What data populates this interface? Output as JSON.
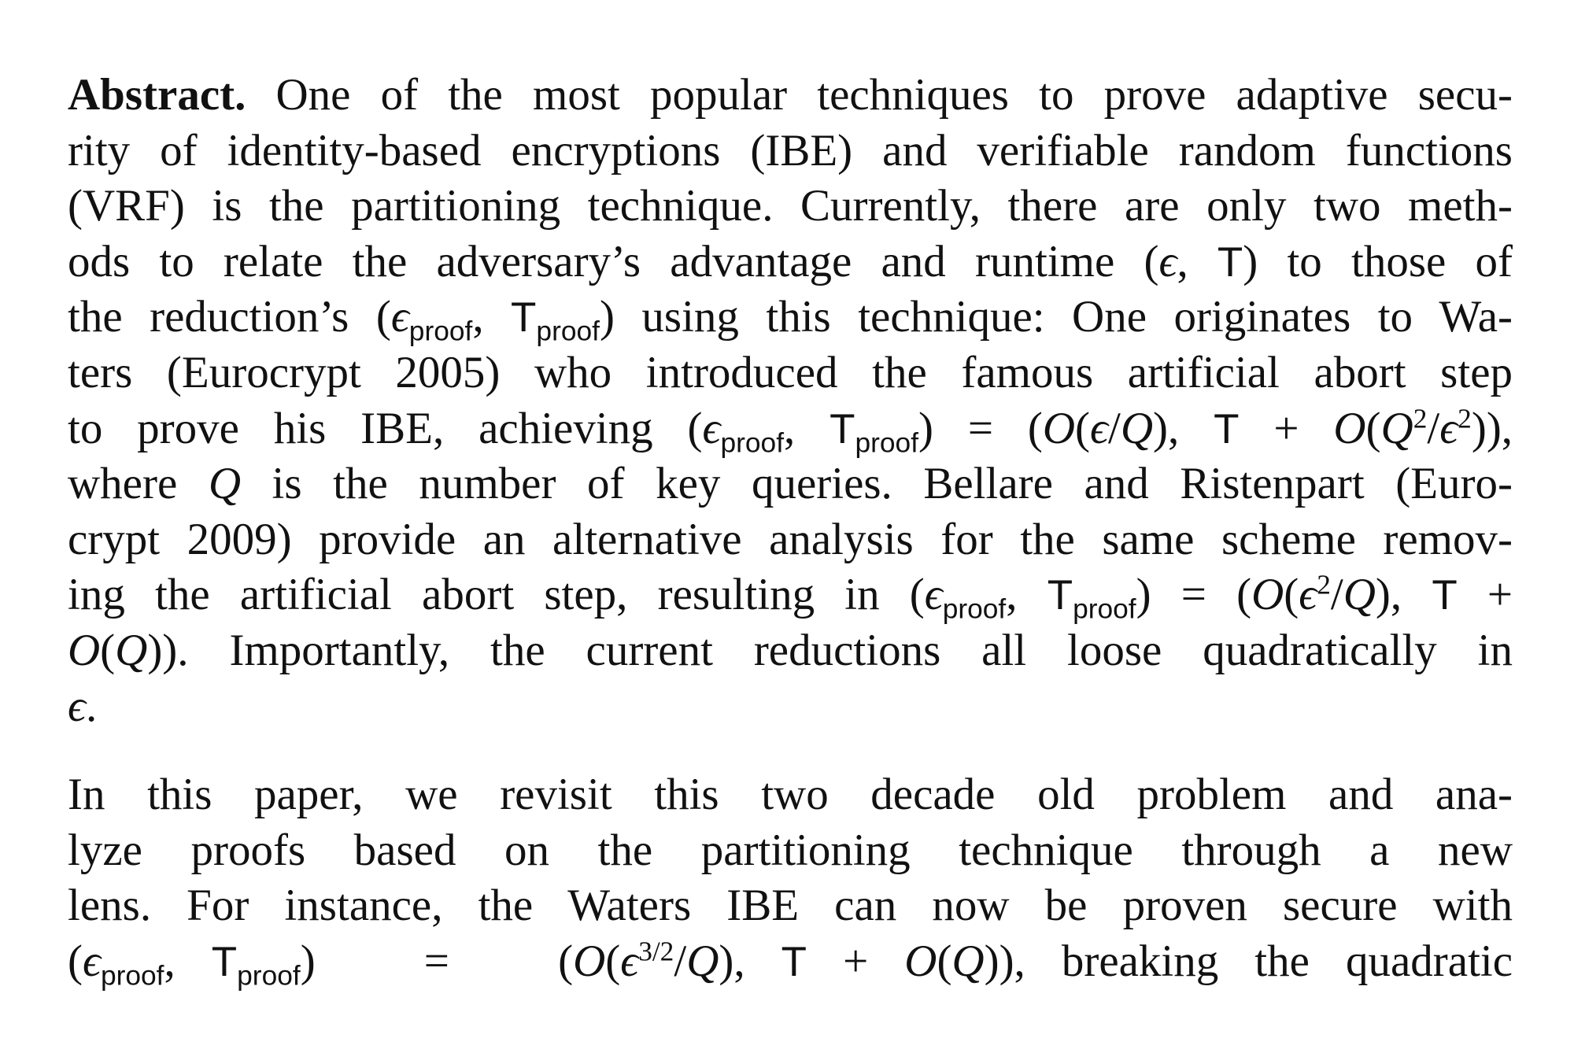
{
  "document": {
    "section_label": "Abstract.",
    "paragraphs": [
      {
        "lines": [
          {
            "parts": [
              {
                "t": "label"
              },
              {
                "text": " One of the most popular techniques to prove adaptive secu-"
              }
            ]
          },
          {
            "parts": [
              {
                "text": "rity of identity-based encryptions (IBE) and verifiable random functions"
              }
            ]
          },
          {
            "parts": [
              {
                "text": "(VRF) is the partitioning technique. Currently, there are only two meth-"
              }
            ]
          },
          {
            "parts": [
              {
                "text": "ods to relate the adversary’s advantage and runtime "
              },
              {
                "math": "(ϵ, T)"
              },
              {
                "text": " to those of"
              }
            ]
          },
          {
            "parts": [
              {
                "text": "the reduction’s "
              },
              {
                "math": "(ϵ_proof, T_proof)"
              },
              {
                "text": " using this technique: One originates to Wa-"
              }
            ]
          },
          {
            "parts": [
              {
                "text": "ters (Eurocrypt 2005) who introduced the famous artificial abort step"
              }
            ]
          },
          {
            "parts": [
              {
                "text": "to prove his IBE, achieving "
              },
              {
                "math": "(ϵ_proof, T_proof) = (O(ϵ/Q), T + O(Q²/ϵ²)),"
              }
            ]
          },
          {
            "parts": [
              {
                "text": "where "
              },
              {
                "math": "Q"
              },
              {
                "text": " is the number of key queries. Bellare and Ristenpart (Euro-"
              }
            ]
          },
          {
            "parts": [
              {
                "text": "crypt 2009) provide an alternative analysis for the same scheme remov-"
              }
            ]
          },
          {
            "parts": [
              {
                "text": "ing the artificial abort step, resulting in "
              },
              {
                "math": "(ϵ_proof, T_proof) = (O(ϵ²/Q), T +"
              }
            ]
          },
          {
            "parts": [
              {
                "math": "O(Q))."
              },
              {
                "text": " Importantly, the current reductions all loose quadratically in"
              }
            ]
          },
          {
            "parts": [
              {
                "math": "ϵ."
              }
            ]
          }
        ]
      },
      {
        "lines": [
          {
            "parts": [
              {
                "text": "In this paper, we revisit this two decade old problem and ana-"
              }
            ]
          },
          {
            "parts": [
              {
                "text": "lyze proofs based on the partitioning technique through a new"
              }
            ]
          },
          {
            "parts": [
              {
                "text": "lens. For instance, the Waters IBE can now be proven secure with"
              }
            ]
          },
          {
            "parts": [
              {
                "math": "(ϵ_proof, T_proof) = (O(ϵ^{3/2}/Q), T + O(Q)),"
              },
              {
                "text": " breaking the quadratic"
              }
            ]
          }
        ]
      }
    ],
    "text": {
      "l1": " One of the most popular techniques to prove adaptive secu-",
      "l2": "rity of identity-based encryptions (IBE) and verifiable random functions",
      "l3": "(VRF) is the partitioning technique. Currently, there are only two meth-",
      "l4a": "ods to relate the adversary’s advantage and runtime ",
      "l4b": " to those of",
      "l5a": "the reduction’s ",
      "l5b": " using this technique: One originates to Wa-",
      "l6": "ters (Eurocrypt 2005) who introduced the famous artificial abort step",
      "l7a": "to prove his IBE, achieving ",
      "l8a": "where ",
      "l8b": " is the number of key queries. Bellare and Ristenpart (Euro-",
      "l9": "crypt 2009) provide an alternative analysis for the same scheme remov-",
      "l10a": "ing the artificial abort step, resulting in ",
      "l11b": " Importantly, the current reductions all loose quadratically in",
      "p2l1": "In this paper, we revisit this two decade old problem and ana-",
      "p2l2": "lyze proofs based on the partitioning technique through a new",
      "p2l3": "lens. For instance, the Waters IBE can now be proven secure with",
      "p2l4b": " breaking the quadratic"
    },
    "symbols": {
      "eps": "ϵ",
      "T": "T",
      "Q": "Q",
      "O": "O",
      "proof": "proof",
      "sq": "2",
      "threehalves": "3/2",
      "eq": "=",
      "plus": "+"
    }
  }
}
